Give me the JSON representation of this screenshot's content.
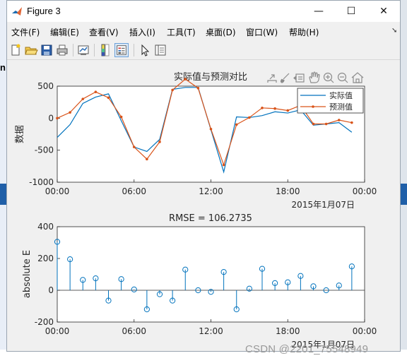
{
  "window": {
    "title": "Figure 3",
    "controls": {
      "minimize": "—",
      "maximize": "☐",
      "close": "✕"
    }
  },
  "menu": [
    {
      "label": "文件(F)"
    },
    {
      "label": "编辑(E)"
    },
    {
      "label": "查看(V)"
    },
    {
      "label": "插入(I)"
    },
    {
      "label": "工具(T)"
    },
    {
      "label": "桌面(D)"
    },
    {
      "label": "窗口(W)"
    },
    {
      "label": "帮助(H)"
    }
  ],
  "toolbar_icons": [
    "new-figure-icon",
    "open-file-icon",
    "save-icon",
    "print-icon",
    "link-plot-icon",
    "colorbar-icon",
    "legend-icon",
    "pointer-icon",
    "property-inspector-icon"
  ],
  "axes_toolbar_icons": [
    "export-icon",
    "brush-icon",
    "data-tips-icon",
    "pan-icon",
    "zoom-in-icon",
    "zoom-out-icon",
    "home-icon"
  ],
  "left_edge_text": "n",
  "watermark": "CSDN @2201_75548949",
  "colors": {
    "actual": "#0072bd",
    "predicted": "#d95319",
    "stem": "#0072bd"
  },
  "chart_data": [
    {
      "type": "line",
      "title": "实际值与预测对比",
      "ylabel": "数据",
      "xlabel": "",
      "x_tick_labels": [
        "00:00",
        "06:00",
        "12:00",
        "18:00",
        "00:00"
      ],
      "x_tick_hours": [
        0,
        6,
        12,
        18,
        24
      ],
      "date_label": "2015年1月07日",
      "xlim": [
        0,
        24
      ],
      "ylim": [
        -1000,
        500
      ],
      "y_ticks": [
        -1000,
        -500,
        0,
        500
      ],
      "grid": false,
      "legend_position": "top-right",
      "x": [
        0,
        1,
        2,
        3,
        4,
        5,
        6,
        7,
        8,
        9,
        10,
        11,
        12,
        13,
        14,
        15,
        16,
        17,
        18,
        19,
        20,
        21,
        22,
        23
      ],
      "series": [
        {
          "name": "实际值",
          "color": "#0072bd",
          "marker": "none",
          "values": [
            -300,
            -100,
            230,
            330,
            380,
            -40,
            -450,
            -520,
            -330,
            450,
            480,
            480,
            -180,
            -840,
            20,
            10,
            40,
            100,
            80,
            130,
            -110,
            -90,
            -70,
            -220
          ]
        },
        {
          "name": "预测值",
          "color": "#d95319",
          "marker": "dot",
          "values": [
            0,
            90,
            300,
            410,
            320,
            20,
            -450,
            -640,
            -370,
            440,
            610,
            470,
            -170,
            -730,
            -100,
            10,
            160,
            150,
            120,
            200,
            -90,
            -90,
            -30,
            -70
          ]
        }
      ]
    },
    {
      "type": "stem",
      "title": "RMSE = 106.2735",
      "ylabel": "absolute E",
      "xlabel": "",
      "x_tick_labels": [
        "00:00",
        "06:00",
        "12:00",
        "18:00",
        "00:00"
      ],
      "x_tick_hours": [
        0,
        6,
        12,
        18,
        24
      ],
      "date_label": "2015年1月07日",
      "xlim": [
        0,
        24
      ],
      "ylim": [
        -200,
        400
      ],
      "y_ticks": [
        -200,
        0,
        200,
        400
      ],
      "grid": false,
      "x": [
        0,
        1,
        2,
        3,
        4,
        5,
        6,
        7,
        8,
        9,
        10,
        11,
        12,
        13,
        14,
        15,
        16,
        17,
        18,
        19,
        20,
        21,
        22,
        23
      ],
      "values": [
        305,
        195,
        65,
        75,
        -65,
        70,
        5,
        -120,
        -25,
        -65,
        130,
        0,
        -10,
        115,
        -120,
        10,
        135,
        45,
        50,
        90,
        25,
        0,
        30,
        150
      ]
    }
  ]
}
